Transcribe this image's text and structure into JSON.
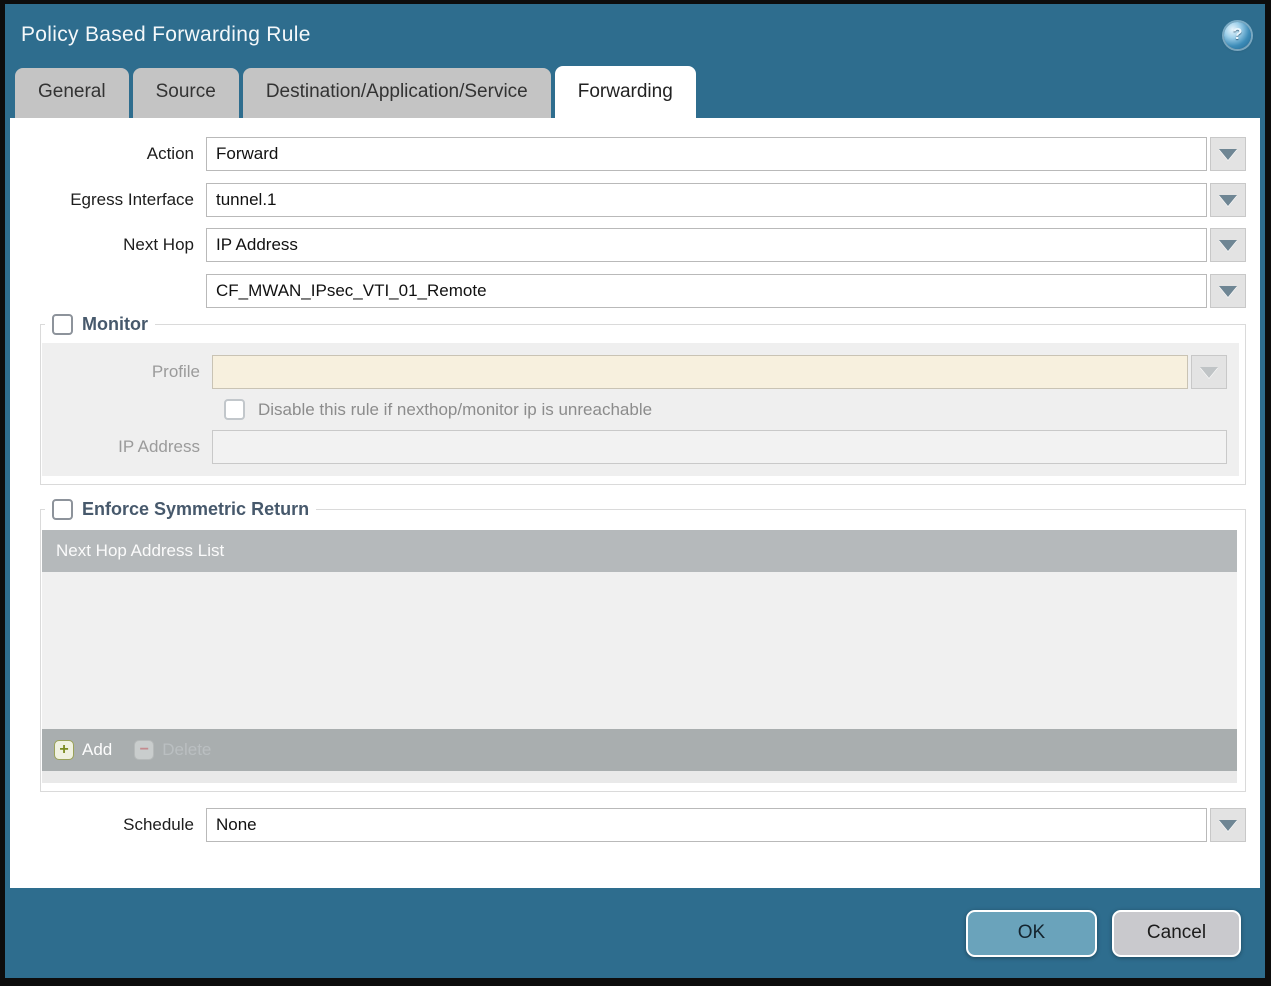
{
  "titlebar": {
    "title": "Policy Based Forwarding Rule",
    "help": "?"
  },
  "tabs": [
    {
      "label": "General",
      "active": false
    },
    {
      "label": "Source",
      "active": false
    },
    {
      "label": "Destination/Application/Service",
      "active": false
    },
    {
      "label": "Forwarding",
      "active": true
    }
  ],
  "form": {
    "action": {
      "label": "Action",
      "value": "Forward"
    },
    "egress": {
      "label": "Egress Interface",
      "value": "tunnel.1"
    },
    "next_hop": {
      "label": "Next Hop",
      "value": "IP Address"
    },
    "next_hop_address": {
      "value": "CF_MWAN_IPsec_VTI_01_Remote"
    },
    "schedule": {
      "label": "Schedule",
      "value": "None"
    }
  },
  "monitor": {
    "legend": "Monitor",
    "checked": false,
    "profile_label": "Profile",
    "profile_value": "",
    "disable_label": "Disable this rule if nexthop/monitor ip is unreachable",
    "disable_checked": false,
    "ip_label": "IP Address",
    "ip_value": ""
  },
  "symmetric_return": {
    "legend": "Enforce Symmetric Return",
    "checked": false,
    "table_header": "Next Hop Address List",
    "rows": [],
    "add_label": "Add",
    "add_icon": "+",
    "delete_label": "Delete",
    "delete_icon": "−"
  },
  "footer": {
    "ok_label": "OK",
    "cancel_label": "Cancel"
  },
  "colors": {
    "titlebar": "#2e6d8e",
    "active_tab": "#ffffff",
    "inactive_tab": "#c4c4c4",
    "ok_button": "#6aa3bb",
    "cancel_button": "#c9c9cd",
    "disabled_field": "#f7f0de"
  }
}
